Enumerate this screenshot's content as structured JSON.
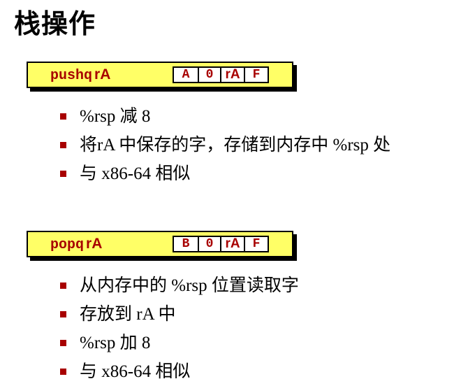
{
  "title": "栈操作",
  "push": {
    "mnemonic": "pushq",
    "operand": "rA",
    "encoding": [
      "A",
      "0",
      "rA",
      "F"
    ],
    "bullets": [
      "%rsp 减 8",
      "将rA 中保存的字，存储到内存中 %rsp 处",
      "与 x86-64 相似"
    ]
  },
  "pop": {
    "mnemonic": "popq",
    "operand": "rA",
    "encoding": [
      "B",
      "0",
      "rA",
      "F"
    ],
    "bullets": [
      "从内存中的 %rsp 位置读取字",
      "存放到 rA 中",
      "%rsp 加 8",
      "与 x86-64 相似"
    ]
  },
  "colors": {
    "accent": "#a80000",
    "box_fill": "#ffff66",
    "shadow": "#000000"
  }
}
